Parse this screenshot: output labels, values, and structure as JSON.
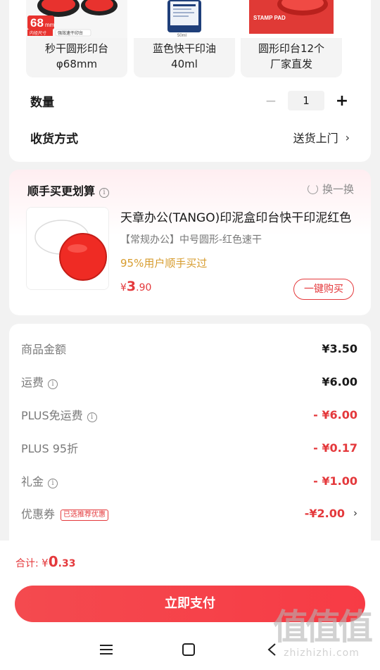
{
  "variants": [
    {
      "label_line1": "秒干圆形印台",
      "label_line2": "φ68mm",
      "badge_big": "68",
      "badge_unit": "mm",
      "badge_small": "内径尺寸",
      "badge_caption": "强效速干印台"
    },
    {
      "label_line1": "蓝色快干印油",
      "label_line2": "40ml",
      "badge_caption": "50ml"
    },
    {
      "label_line1": "圆形印台12个",
      "label_line2": "厂家直发",
      "badge_caption": "STAMP PAD"
    }
  ],
  "quantity": {
    "label": "数量",
    "minus": "−",
    "value": "1",
    "plus": "+"
  },
  "shipping": {
    "label": "收货方式",
    "value": "送货上门",
    "chevron": "›"
  },
  "recommend": {
    "title": "顺手买更划算",
    "info": "i",
    "swap_label": "换一换",
    "product_name": "天章办公(TANGO)印泥盒印台快干印泥红色",
    "spec": "【常规办公】中号圆形-红色速干",
    "tag": "95%用户顺手买过",
    "price_symbol": "¥",
    "price_int": "3",
    "price_dec": ".90",
    "buy_label": "一键购买"
  },
  "summary": [
    {
      "label": "商品金额",
      "value": "¥3.50",
      "info": false,
      "red": false
    },
    {
      "label": "运费",
      "value": "¥6.00",
      "info": true,
      "red": false
    },
    {
      "label": "PLUS免运费",
      "value": "- ¥6.00",
      "info": true,
      "red": true
    },
    {
      "label": "PLUS 95折",
      "value": "- ¥0.17",
      "info": false,
      "red": true
    },
    {
      "label": "礼金",
      "value": "- ¥1.00",
      "info": true,
      "red": true
    },
    {
      "label": "优惠券",
      "value": "-¥2.00",
      "info": false,
      "red": true,
      "badge": "已选推荐优惠",
      "chevron": "›"
    }
  ],
  "total": {
    "label": "合计:",
    "symbol": "¥",
    "int": "0",
    "dec": ".33"
  },
  "pay_button": "立即支付",
  "nav": {
    "menu": "menu-icon",
    "home": "home-icon",
    "back": "back-icon"
  },
  "watermark": {
    "glyphs": "值值值",
    "site": "zhizhizhi.com"
  },
  "colors": {
    "accent": "#e4393c",
    "gold": "#d79c2e",
    "background": "#f2f2f2"
  }
}
